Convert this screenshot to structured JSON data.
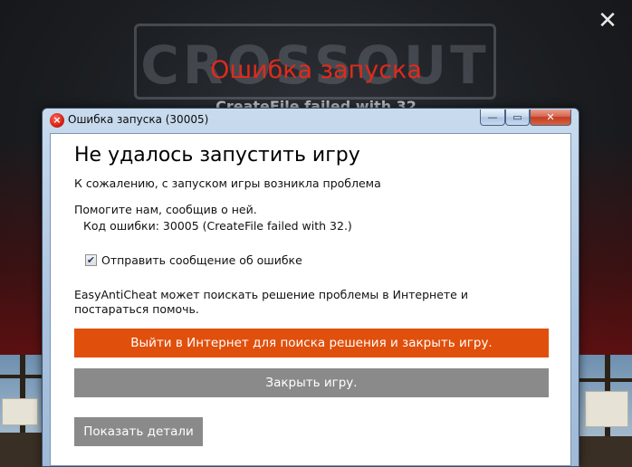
{
  "background": {
    "logo_text": "CROSSOUT",
    "error_title": "Ошибка запуска",
    "error_subtitle": "CreateFile failed with 32",
    "close_glyph": "✕",
    "colors": {
      "title_red": "#e02a1c"
    }
  },
  "dialog": {
    "title": "Ошибка запуска (30005)",
    "title_icon": "error-icon",
    "title_icon_glyph": "×",
    "controls": {
      "minimize": "—",
      "maximize": "▭",
      "close": "✕"
    },
    "heading": "Не удалось запустить игру",
    "sorry_text": "К сожалению, с запуском игры возникла проблема",
    "help_text": "Помогите нам, сообщив о ней.",
    "error_code_text": "Код ошибки: 30005 (CreateFile failed with 32.)",
    "send_report": {
      "label": "Отправить сообщение об ошибке",
      "checked": true,
      "check_glyph": "✔"
    },
    "eac_text": "EasyAntiCheat может поискать решение проблемы в Интернете и постараться помочь.",
    "buttons": {
      "search_online": "Выйти в Интернет для поиска решения и закрыть игру.",
      "close_game": "Закрыть игру.",
      "show_details": "Показать детали"
    },
    "colors": {
      "primary_button": "#e04f0b",
      "secondary_button": "#8a8a8a"
    }
  }
}
